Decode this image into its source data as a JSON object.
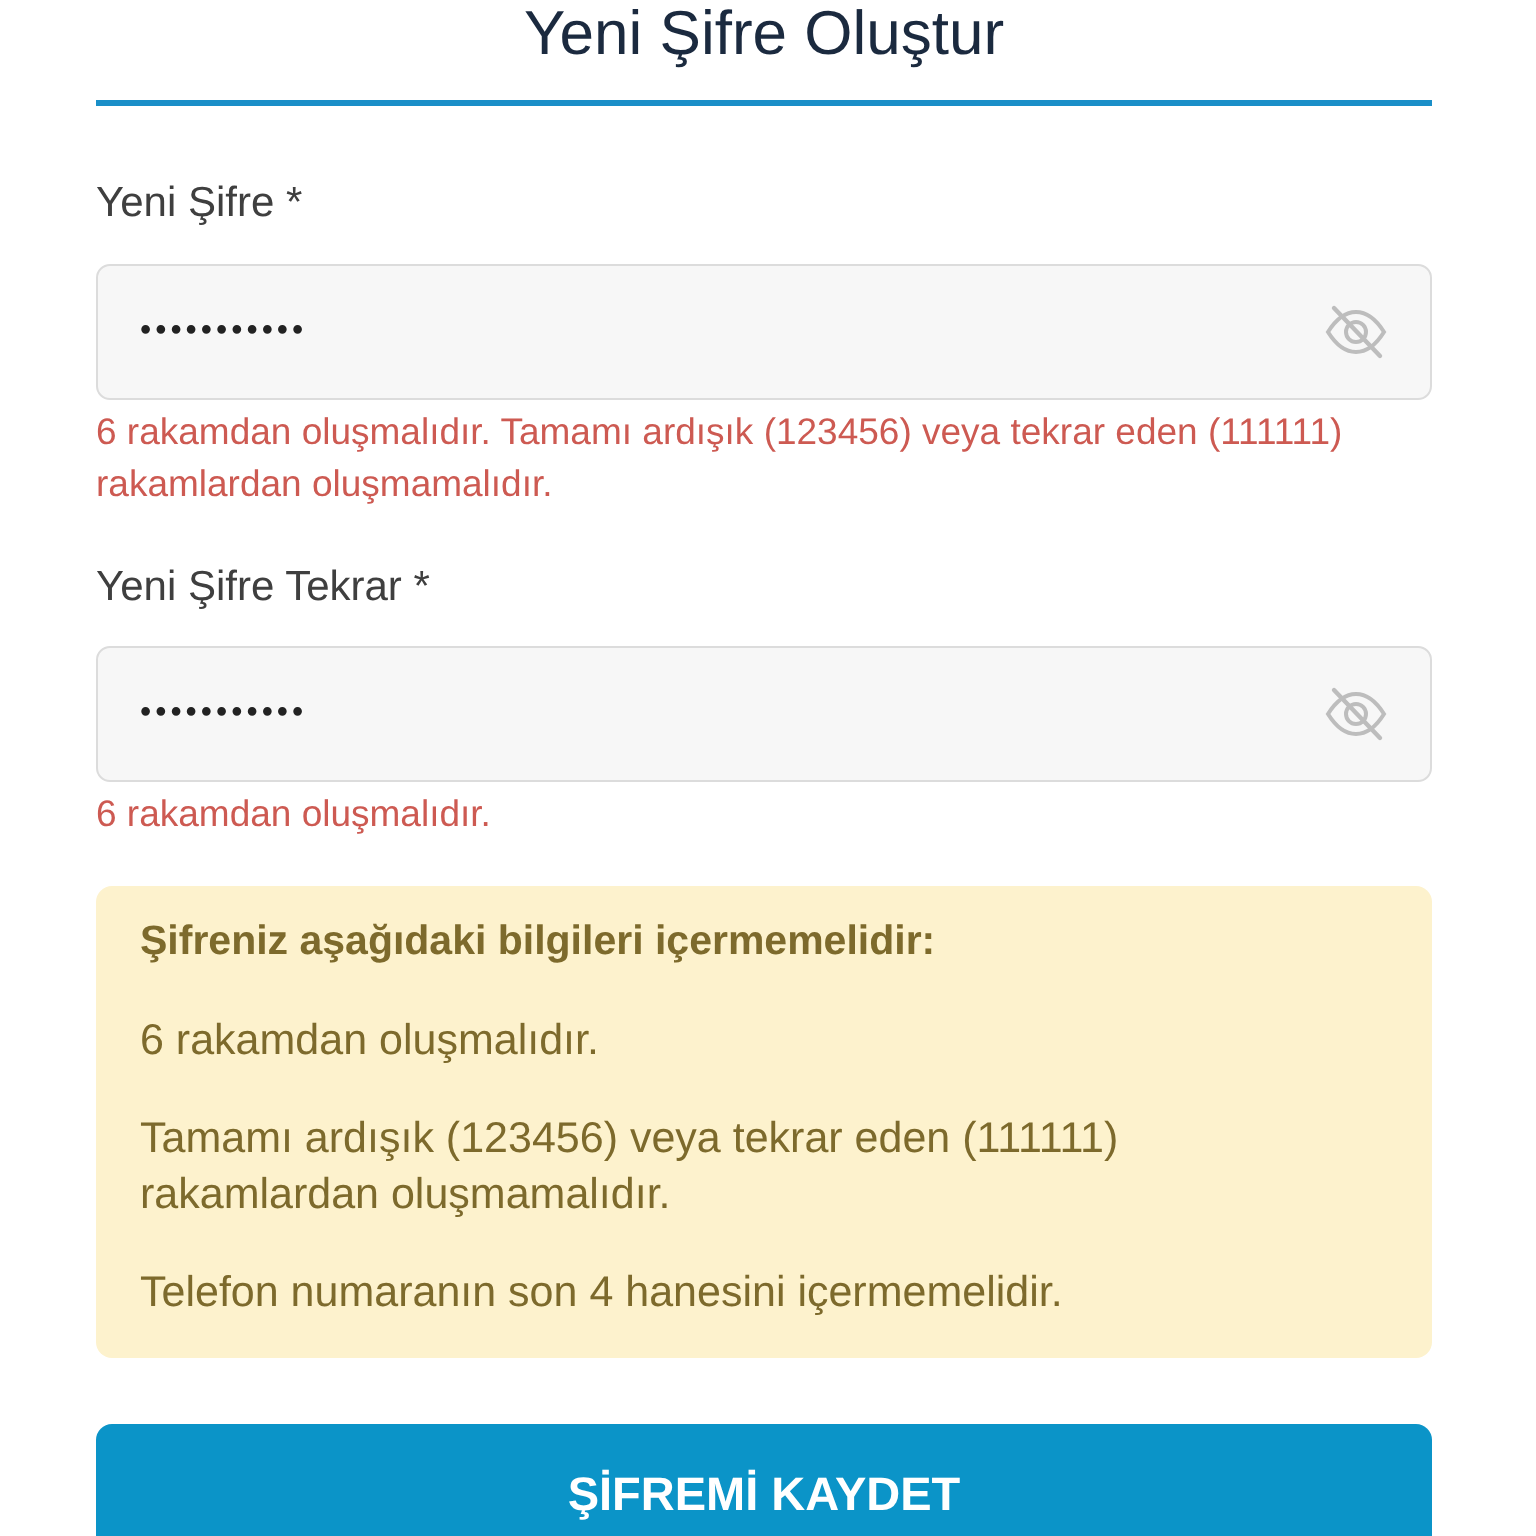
{
  "title": "Yeni Şifre Oluştur",
  "fields": [
    {
      "label": "Yeni Şifre *",
      "value": "•••••••••••",
      "error": "6 rakamdan oluşmalıdır. Tamamı ardışık (123456) veya tekrar eden (111111) rakamlardan oluşmamalıdır."
    },
    {
      "label": "Yeni Şifre Tekrar *",
      "value": "•••••••••••",
      "error": "6 rakamdan oluşmalıdır."
    }
  ],
  "rules_box": {
    "heading": "Şifreniz aşağıdaki bilgileri içermemelidir:",
    "items": [
      "6 rakamdan oluşmalıdır.",
      "Tamamı ardışık (123456) veya tekrar eden (111111) rakamlardan oluşmamalıdır.",
      "Telefon numaranın son 4 hanesini içermemelidir."
    ]
  },
  "save_button": "ŞİFREMİ KAYDET"
}
